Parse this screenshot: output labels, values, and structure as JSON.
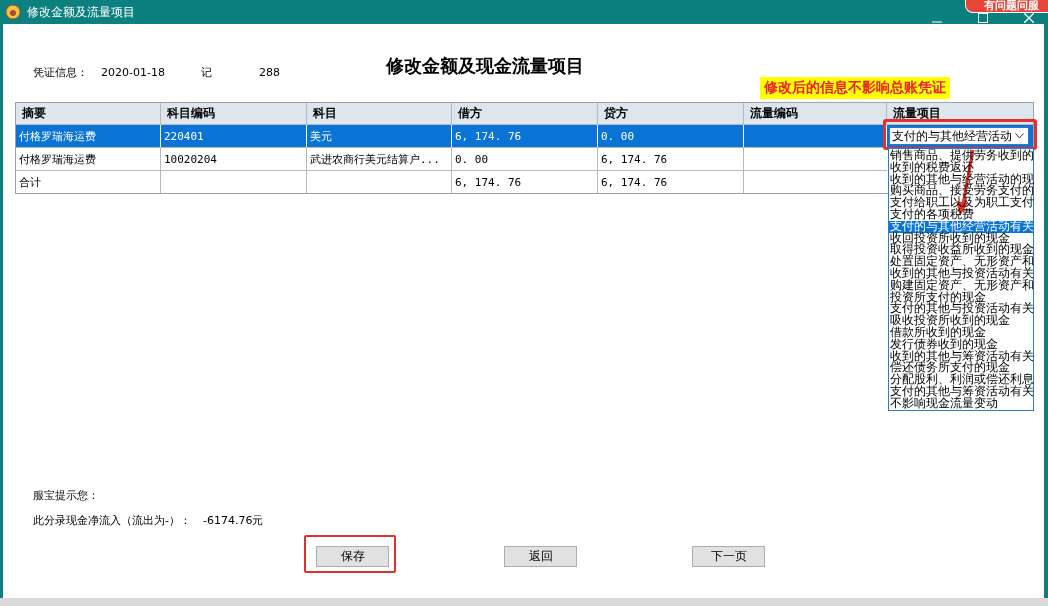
{
  "window": {
    "title": "修改金额及流量项目"
  },
  "chat_badge": {
    "label": "有问题问服"
  },
  "voucher": {
    "label": "凭证信息：",
    "date": "2020-01-18",
    "type": "记",
    "number": "288"
  },
  "heading": "修改金额及现金流量项目",
  "note": "修改后的信息不影响总账凭证",
  "table": {
    "columns": [
      "摘要",
      "科目编码",
      "科目",
      "借方",
      "贷方",
      "流量编码",
      "流量项目"
    ],
    "rows": [
      {
        "selected": true,
        "cells": [
          "付格罗瑞海运费",
          "220401",
          "美元",
          "6, 174. 76",
          "0. 00",
          "",
          ""
        ],
        "combo": {
          "value": "支付的与其他经营活动"
        }
      },
      {
        "selected": false,
        "cells": [
          "付格罗瑞海运费",
          "10020204",
          "武进农商行美元结算户...",
          "0. 00",
          "6, 174. 76",
          "",
          ""
        ]
      },
      {
        "selected": false,
        "cells": [
          "合计",
          "",
          "",
          "6, 174. 76",
          "6, 174. 76",
          "",
          ""
        ]
      }
    ]
  },
  "dropdown": {
    "options": [
      {
        "label": "销售商品、提供劳务收到的",
        "selected": false
      },
      {
        "label": "收到的税费返还",
        "selected": false
      },
      {
        "label": "收到的其他与经营活动的现",
        "selected": false
      },
      {
        "label": "购买商品、接受劳务支付的",
        "selected": false
      },
      {
        "label": "支付给职工以及为职工支付",
        "selected": false
      },
      {
        "label": "支付的各项税费",
        "selected": false
      },
      {
        "label": "支付的与其他经营活动有关",
        "selected": true
      },
      {
        "label": "收回投资所收到的现金",
        "selected": false
      },
      {
        "label": "取得投资收益所收到的现金",
        "selected": false
      },
      {
        "label": "处置固定资产、无形资产和",
        "selected": false
      },
      {
        "label": "收到的其他与投资活动有关",
        "selected": false
      },
      {
        "label": "购建固定资产、无形资产和",
        "selected": false
      },
      {
        "label": "投资所支付的现金",
        "selected": false
      },
      {
        "label": "支付的其他与投资活动有关",
        "selected": false
      },
      {
        "label": "吸收投资所收到的现金",
        "selected": false
      },
      {
        "label": "借款所收到的现金",
        "selected": false
      },
      {
        "label": "发行债券收到的现金",
        "selected": false
      },
      {
        "label": "收到的其他与筹资活动有关",
        "selected": false
      },
      {
        "label": "偿还债务所支付的现金",
        "selected": false
      },
      {
        "label": "分配股利、利润或偿还利息",
        "selected": false
      },
      {
        "label": "支付的其他与筹资活动有关",
        "selected": false
      },
      {
        "label": "不影响现金流量变动",
        "selected": false
      }
    ]
  },
  "tip": {
    "title": "服宝提示您：",
    "label": "此分录现金净流入（流出为-）：",
    "value": "-6174.76元"
  },
  "buttons": [
    {
      "label": "保存",
      "highlighted": true
    },
    {
      "label": "返回",
      "highlighted": false
    },
    {
      "label": "下一页",
      "highlighted": false
    }
  ]
}
